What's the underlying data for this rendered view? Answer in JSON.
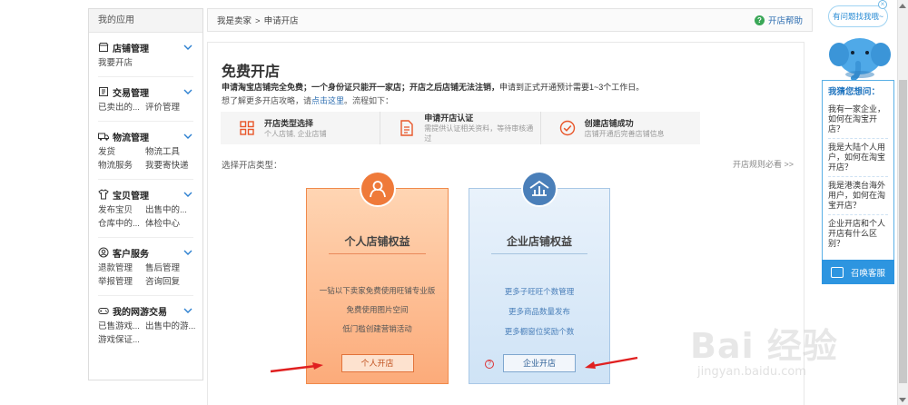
{
  "sidebar": {
    "title": "我的应用",
    "sections": [
      {
        "label": "店铺管理",
        "links": [
          "我要开店"
        ]
      },
      {
        "label": "交易管理",
        "links": [
          "已卖出的...",
          "评价管理"
        ]
      },
      {
        "label": "物流管理",
        "links": [
          "发货",
          "物流工具",
          "物流服务",
          "我要寄快递"
        ]
      },
      {
        "label": "宝贝管理",
        "links": [
          "发布宝贝",
          "出售中的...",
          "仓库中的...",
          "体检中心"
        ]
      },
      {
        "label": "客户服务",
        "links": [
          "退款管理",
          "售后管理",
          "举报管理",
          "咨询回复"
        ]
      },
      {
        "label": "我的网游交易",
        "links": [
          "已售游戏...",
          "出售中的游...",
          "游戏保证..."
        ]
      }
    ]
  },
  "breadcrumb": {
    "root": "我是卖家",
    "sep": ">",
    "current": "申请开店"
  },
  "help": {
    "icon": "question-icon",
    "label": "开店帮助"
  },
  "main": {
    "title": "免费开店",
    "desc_bold": "申请淘宝店铺完全免费；一个身份证只能开一家店；开店之后店铺无法注销，",
    "desc_rest": "申请到正式开通预计需要1~3个工作日。",
    "desc2_pre": "想了解更多开店攻略，请",
    "desc2_link": "点击这里",
    "desc2_post": "。流程如下：",
    "steps": [
      {
        "title": "开店类型选择",
        "desc": "个人店铺, 企业店铺",
        "icon": "grid-icon",
        "color": "#e8562a"
      },
      {
        "title": "申请开店认证",
        "desc": "需提供认证相关资料，等待审核通过",
        "icon": "document-icon",
        "color": "#e8562a"
      },
      {
        "title": "创建店铺成功",
        "desc": "店铺开通后完善店铺信息",
        "icon": "check-circle-icon",
        "color": "#e8562a"
      }
    ],
    "choose_label": "选择开店类型：",
    "rules_link": "开店规则必看 >>"
  },
  "cards": {
    "personal": {
      "title": "个人店铺权益",
      "features": [
        "一钻以下卖家免费使用旺铺专业版",
        "免费使用图片空间",
        "低门槛创建营销活动"
      ],
      "button": "个人开店",
      "icon": "person-icon",
      "accent": "#ef7a3a"
    },
    "company": {
      "title": "企业店铺权益",
      "features": [
        "更多子旺旺个数管理",
        "更多商品数量发布",
        "更多橱窗位奖励个数"
      ],
      "button": "企业开店",
      "help_mark": "?",
      "icon": "enterprise-icon",
      "accent": "#4a7fb9"
    }
  },
  "assistant": {
    "bubble": "有问题找我哦~",
    "close": "×",
    "heading": "我猜您想问：",
    "questions": [
      "我有一家企业，如何在淘宝开店？",
      "我是大陆个人用户，如何在淘宝开店？",
      "我是港澳台海外用户，如何在淘宝开店？",
      "企业开店和个人开店有什么区别？"
    ],
    "call_button": "召唤客服"
  },
  "watermark": {
    "text": "Bai 经验",
    "url": "jingyan.baidu.com"
  }
}
